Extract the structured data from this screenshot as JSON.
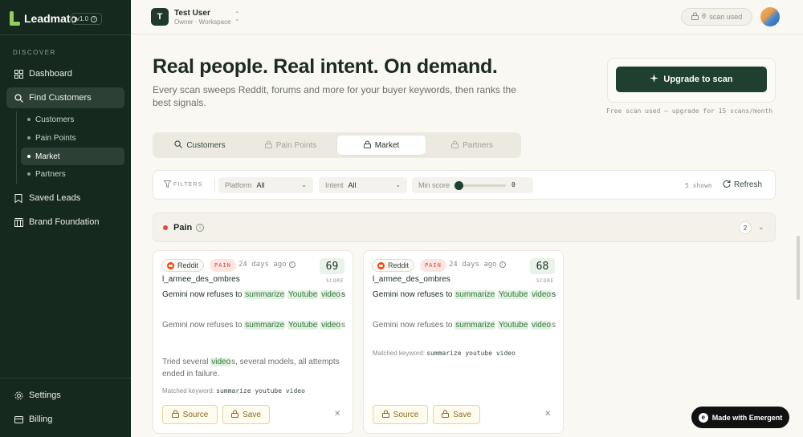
{
  "brand": {
    "name": "Leadmato",
    "version": "v1.0"
  },
  "sidebar": {
    "section_label": "DISCOVER",
    "items": [
      {
        "label": "Dashboard",
        "icon": "grid-icon"
      },
      {
        "label": "Find Customers",
        "icon": "search-icon",
        "active": true
      },
      {
        "label": "Saved Leads",
        "icon": "bookmark-icon"
      },
      {
        "label": "Brand Foundation",
        "icon": "building-icon"
      }
    ],
    "sub_items": [
      {
        "label": "Customers"
      },
      {
        "label": "Pain Points"
      },
      {
        "label": "Market",
        "active": true
      },
      {
        "label": "Partners"
      }
    ],
    "footer_items": [
      {
        "label": "Settings",
        "icon": "gear-icon"
      },
      {
        "label": "Billing",
        "icon": "billing-icon"
      }
    ]
  },
  "topbar": {
    "workspace_initial": "T",
    "workspace_name": "Test User",
    "workspace_role": "Owner · Workspace",
    "scan_count": "0",
    "scan_label": "scan used"
  },
  "hero": {
    "title": "Real people. Real intent. On demand.",
    "subtitle": "Every scan sweeps Reddit, forums and more for your buyer keywords, then ranks the best signals.",
    "upgrade_label": "Upgrade to scan",
    "upgrade_note": "Free scan used — upgrade for 15 scans/month"
  },
  "tabs": [
    {
      "label": "Customers",
      "icon": "search-icon"
    },
    {
      "label": "Pain Points",
      "icon": "lock-icon"
    },
    {
      "label": "Market",
      "icon": "lock-icon",
      "active": true
    },
    {
      "label": "Partners",
      "icon": "lock-icon"
    }
  ],
  "filters": {
    "label": "FILTERS",
    "platform_key": "Platform",
    "platform_value": "All",
    "intent_key": "Intent",
    "intent_value": "All",
    "min_score_key": "Min score",
    "min_score_value": "0",
    "shown": "5 shown",
    "refresh_label": "Refresh"
  },
  "section": {
    "title": "Pain",
    "count": "2",
    "status_color": "#e04a3a"
  },
  "cards": [
    {
      "source": "Reddit",
      "intent": "PAIN",
      "age": "24 days ago",
      "score": "69",
      "score_label": "SCORE",
      "user": "l_armee_des_ombres",
      "title": {
        "t1": "Gemini now refuses to ",
        "h1": "summarize",
        "t2": " ",
        "h2": "Youtube",
        "t3": " ",
        "h3": "video",
        "t4": "s"
      },
      "body": {
        "t1": "Gemini now refuses to ",
        "h1": "summarize",
        "t2": " ",
        "h2": "Youtube",
        "t3": " ",
        "h3": "video",
        "t4": "s"
      },
      "body2": {
        "t1": "Tried several ",
        "h1": "video",
        "t2": "s, several models, all attempts ended in failure."
      },
      "keyword_label": "Matched keyword:",
      "keyword": "summarize youtube video",
      "source_btn": "Source",
      "save_btn": "Save"
    },
    {
      "source": "Reddit",
      "intent": "PAIN",
      "age": "24 days ago",
      "score": "68",
      "score_label": "SCORE",
      "user": "l_armee_des_ombres",
      "title": {
        "t1": "Gemini now refuses to ",
        "h1": "summarize",
        "t2": " ",
        "h2": "Youtube",
        "t3": " ",
        "h3": "video",
        "t4": "s"
      },
      "body": {
        "t1": "Gemini now refuses to ",
        "h1": "summarize",
        "t2": " ",
        "h2": "Youtube",
        "t3": " ",
        "h3": "video",
        "t4": "s"
      },
      "keyword_label": "Matched keyword:",
      "keyword": "summarize youtube video",
      "source_btn": "Source",
      "save_btn": "Save"
    }
  ],
  "emergent": {
    "label": "Made with Emergent"
  }
}
